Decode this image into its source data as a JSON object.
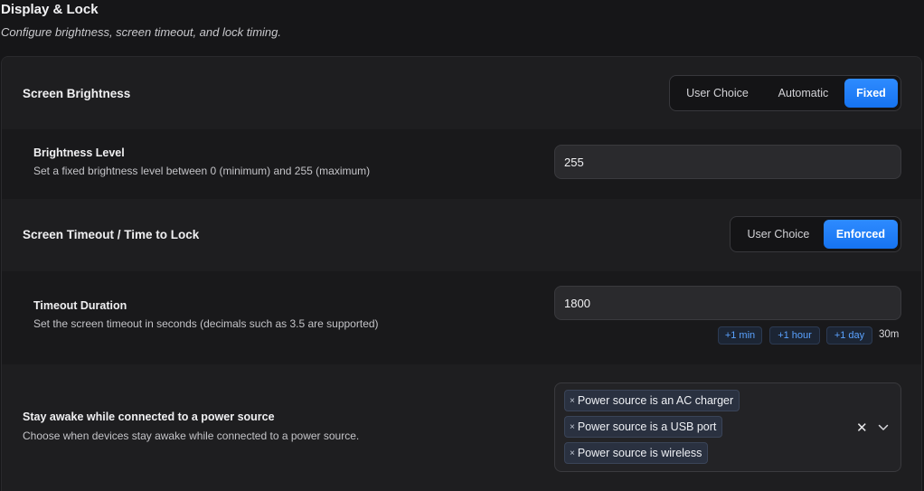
{
  "header": {
    "title": "Display & Lock",
    "subtitle": "Configure brightness, screen timeout, and lock timing."
  },
  "brightness": {
    "title": "Screen Brightness",
    "options": [
      "User Choice",
      "Automatic",
      "Fixed"
    ],
    "selected": "Fixed",
    "level": {
      "label": "Brightness Level",
      "description": "Set a fixed brightness level between 0 (minimum) and 255 (maximum)",
      "value": "255"
    }
  },
  "timeout": {
    "title": "Screen Timeout / Time to Lock",
    "options": [
      "User Choice",
      "Enforced"
    ],
    "selected": "Enforced",
    "duration": {
      "label": "Timeout Duration",
      "description": "Set the screen timeout in seconds (decimals such as 3.5 are supported)",
      "value": "1800",
      "quick_add": [
        "+1 min",
        "+1 hour",
        "+1 day"
      ],
      "readout": "30m"
    }
  },
  "stay_awake": {
    "title": "Stay awake while connected to a power source",
    "description": "Choose when devices stay awake while connected to a power source.",
    "tag_remove_glyph": "×",
    "selected_tags": [
      "Power source is an AC charger",
      "Power source is a USB port",
      "Power source is wireless"
    ],
    "clear_glyph": "✕",
    "icons": {
      "clear": "close-icon",
      "dropdown": "chevron-down-icon"
    }
  },
  "colors": {
    "accent": "#1f80ff",
    "background": "#161618",
    "card": "#1e1e20",
    "sub_row": "#19191b"
  }
}
